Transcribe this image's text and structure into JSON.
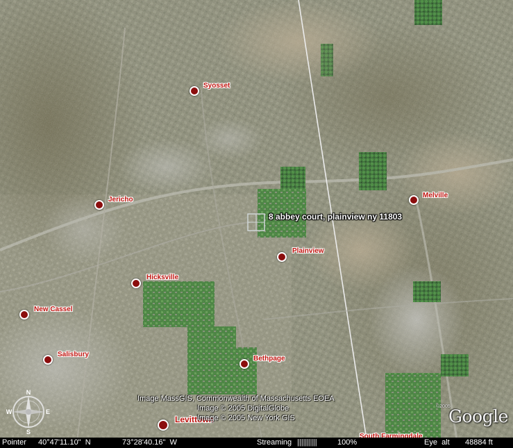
{
  "search_result": {
    "label": "8 abbey court, plainview ny 11803"
  },
  "places": [
    {
      "key": "syosset",
      "name": "Syosset"
    },
    {
      "key": "jericho",
      "name": "Jericho"
    },
    {
      "key": "melville",
      "name": "Melville"
    },
    {
      "key": "plainview",
      "name": "Plainview"
    },
    {
      "key": "hicksville",
      "name": "Hicksville"
    },
    {
      "key": "new_cassel",
      "name": "New Cassel"
    },
    {
      "key": "salisbury",
      "name": "Salisbury"
    },
    {
      "key": "bethpage",
      "name": "Bethpage"
    },
    {
      "key": "levittown",
      "name": "Levittown"
    },
    {
      "key": "south_farmingdale",
      "name": "South Farmingdale"
    }
  ],
  "credits": [
    "Image MassGIS, Commonwealth of Massachusetts EOEA",
    "Image © 2005 DigitalGlobe",
    "Image © 2005 New York GIS"
  ],
  "logo": {
    "text": "Google",
    "copyright": "©2005"
  },
  "compass": {
    "n": "N",
    "e": "E",
    "s": "S",
    "w": "W"
  },
  "status": {
    "pointer_label": "Pointer",
    "latitude": "40°47'11.10\"  N",
    "longitude": "73°28'40.16\"  W",
    "streaming_label": "Streaming",
    "streaming_bar": "||||||||||",
    "streaming_pct": "100%",
    "eye_alt_label": "Eye  alt",
    "eye_alt_value": "48884 ft"
  },
  "colors": {
    "place_label": "#c0140f",
    "place_dot": "#8b0d0d",
    "status_bg": "#000000"
  }
}
